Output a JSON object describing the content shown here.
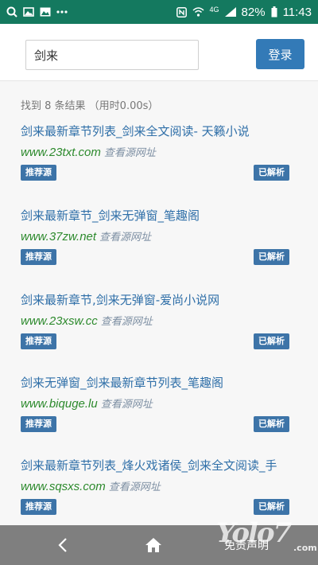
{
  "status_bar": {
    "battery": "82%",
    "time": "11:43",
    "network": "4G",
    "icons": [
      "search-icon",
      "image-icon",
      "photo-icon",
      "more-icon",
      "nfc-icon",
      "wifi-icon",
      "signal-icon",
      "battery-icon"
    ]
  },
  "header": {
    "search_value": "剑来",
    "login_label": "登录"
  },
  "results": {
    "summary": "找到 8 条结果 （用时0.00s）",
    "items": [
      {
        "title": "剑来最新章节列表_剑来全文阅读- 天籁小说",
        "url": "www.23txt.com",
        "view": "查看源网址",
        "badge_left": "推荐源",
        "badge_right": "已解析"
      },
      {
        "title": "剑来最新章节_剑来无弹窗_笔趣阁",
        "url": "www.37zw.net",
        "view": "查看源网址",
        "badge_left": "推荐源",
        "badge_right": "已解析"
      },
      {
        "title": "剑来最新章节,剑来无弹窗-爱尚小说网",
        "url": "www.23xsw.cc",
        "view": "查看源网址",
        "badge_left": "推荐源",
        "badge_right": "已解析"
      },
      {
        "title": "剑来无弹窗_剑来最新章节列表_笔趣阁",
        "url": "www.biquge.lu",
        "view": "查看源网址",
        "badge_left": "推荐源",
        "badge_right": "已解析"
      },
      {
        "title": "剑来最新章节列表_烽火戏诸侯_剑来全文阅读_手",
        "url": "www.sqsxs.com",
        "view": "查看源网址",
        "badge_left": "推荐源",
        "badge_right": "已解析"
      }
    ]
  },
  "bottom_bar": {
    "disclaimer": "免责声明",
    "watermark": "Yolo7",
    "watermark_suffix": ".com"
  },
  "colors": {
    "status_bar": "#14795f",
    "accent": "#337ab7",
    "title_link": "#2f6fa8",
    "url": "#2d8a2d",
    "badge": "#3d74a8",
    "bottom_bar": "#7f7f7f"
  }
}
